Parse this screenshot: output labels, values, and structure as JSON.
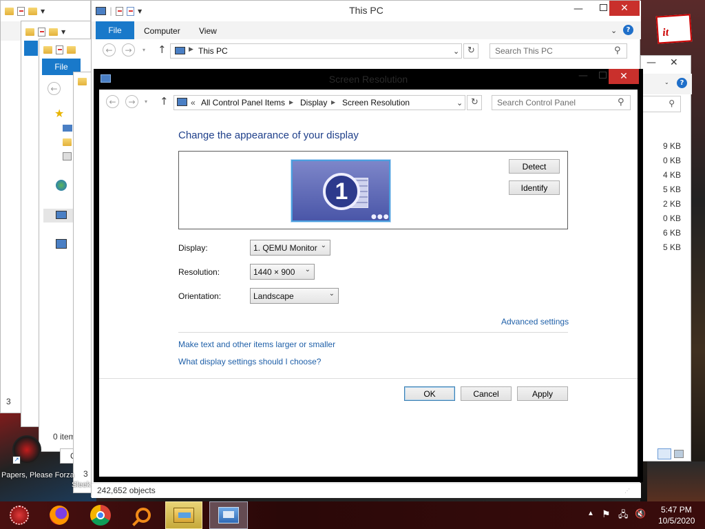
{
  "bg_windows": {
    "w2_file_tab": "File",
    "w2_status": "0 item",
    "w1_status_digit": "3",
    "w3_status_digit": "3",
    "side_status_digit": "3",
    "right_sizes": [
      "9 KB",
      "0 KB",
      "4 KB",
      "5 KB",
      "2 KB",
      "0 KB",
      "6 KB",
      "5 KB"
    ],
    "partial_text_it": "it",
    "box_c": "C"
  },
  "this_pc": {
    "title": "This PC",
    "ribbon_tabs": [
      "File",
      "Computer",
      "View"
    ],
    "address": "This PC",
    "search_placeholder": "Search This PC",
    "status": "242,652 objects"
  },
  "dialog": {
    "title": "Screen Resolution",
    "breadcrumb": {
      "prefix": "«",
      "items": [
        "All Control Panel Items",
        "Display",
        "Screen Resolution"
      ]
    },
    "search_placeholder": "Search Control Panel",
    "heading": "Change the appearance of your display",
    "monitor_number": "1",
    "detect_label": "Detect",
    "identify_label": "Identify",
    "display_label": "Display:",
    "display_value": "1. QEMU Monitor",
    "resolution_label": "Resolution:",
    "resolution_value": "1440 × 900",
    "orientation_label": "Orientation:",
    "orientation_value": "Landscape",
    "advanced_link": "Advanced settings",
    "link_text_size": "Make text and other items larger or smaller",
    "link_which_settings": "What display settings should I choose?",
    "ok_label": "OK",
    "cancel_label": "Cancel",
    "apply_label": "Apply"
  },
  "desktop": {
    "icon_label": "Papers, Please Forza",
    "icon_label2": "Sleek"
  },
  "taskbar": {
    "apps": [
      "start-icon",
      "firefox-icon",
      "chrome-icon",
      "search-icon",
      "file-explorer-icon",
      "control-panel-icon"
    ],
    "time": "5:47 PM",
    "date": "10/5/2020"
  },
  "colors": {
    "accent": "#1979ca",
    "close": "#c9302c",
    "link": "#1e5fa8",
    "taskbar": "#3a0c0c"
  }
}
